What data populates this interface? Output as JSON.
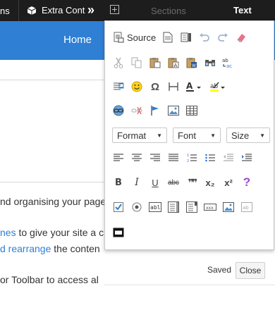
{
  "topbar": {
    "left_fragment": "ns",
    "extra_label": "Extra Cont",
    "chevron": "»",
    "plus": "⊞",
    "sections_label": "Sections",
    "text_label": "Text"
  },
  "header": {
    "home_label": "Home"
  },
  "content": {
    "line1": "nd organising your page",
    "line2_link": "nes",
    "line2_rest": " to give your site a c",
    "line3_link": "d rearrange",
    "line3_rest": " the conten",
    "line4": "or Toolbar to access al"
  },
  "toolbar": {
    "source_label": "Source",
    "format_label": "Format",
    "font_label": "Font",
    "size_label": "Size",
    "bold_glyph": "B",
    "italic_glyph": "I",
    "underline_glyph": "U",
    "strike_glyph": "abc",
    "quote_glyph": "❞❞",
    "subscript_glyph": "x₂",
    "superscript_glyph": "x²",
    "help_glyph": "?",
    "omega_glyph": "Ω",
    "textfield_glyph": "abl",
    "spell_glyph": "abc"
  },
  "footer": {
    "saved_label": "Saved",
    "close_label": "Close"
  },
  "colors": {
    "header_blue": "#2f7fd4",
    "topbar_dark": "#1d1d1d",
    "help_purple": "#9b4dca"
  }
}
